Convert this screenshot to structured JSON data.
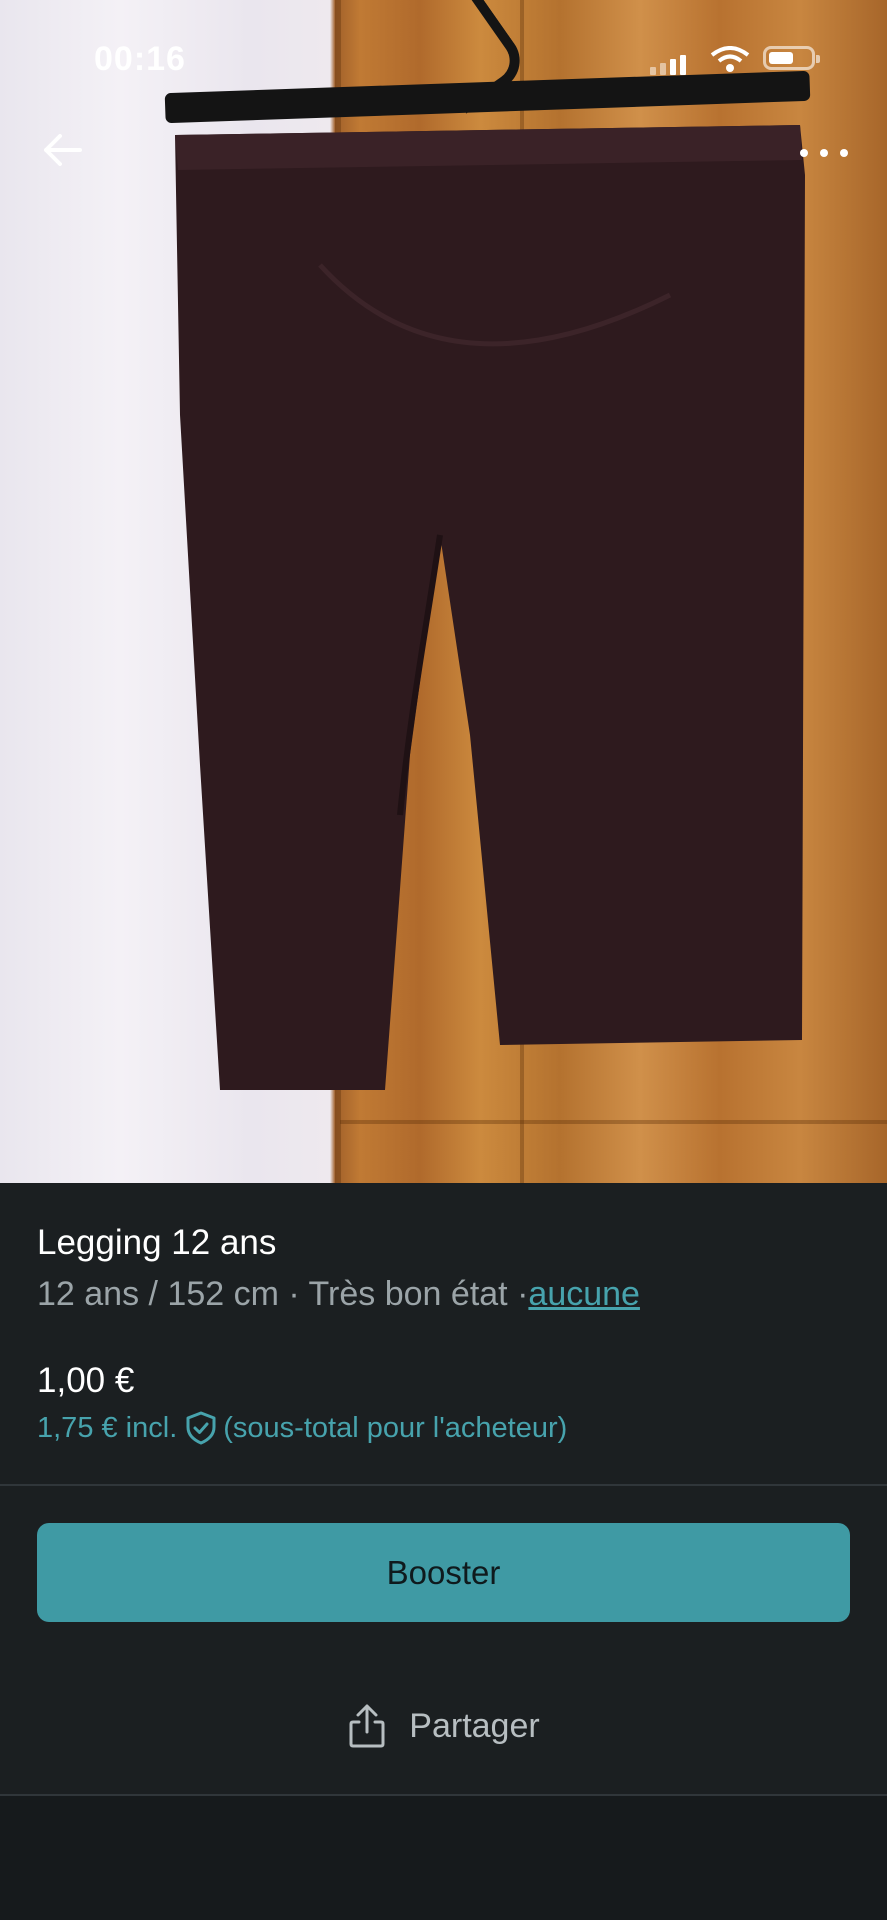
{
  "status_bar": {
    "time": "00:16"
  },
  "header": {
    "back_icon": "arrow-left-icon",
    "more_icon": "more-horizontal-icon"
  },
  "item": {
    "title": "Legging 12 ans",
    "size": "12 ans / 152 cm",
    "separator": "·",
    "condition": "Très bon état",
    "brand_link": "aucune",
    "price": "1,00 €",
    "buyer_price": "1,75 € incl.",
    "buyer_note": "(sous-total pour l'acheteur)"
  },
  "actions": {
    "boost_label": "Booster",
    "share_label": "Partager"
  },
  "colors": {
    "accent": "#3f9aa4",
    "link": "#47a3ad",
    "background": "#1b1f21"
  }
}
